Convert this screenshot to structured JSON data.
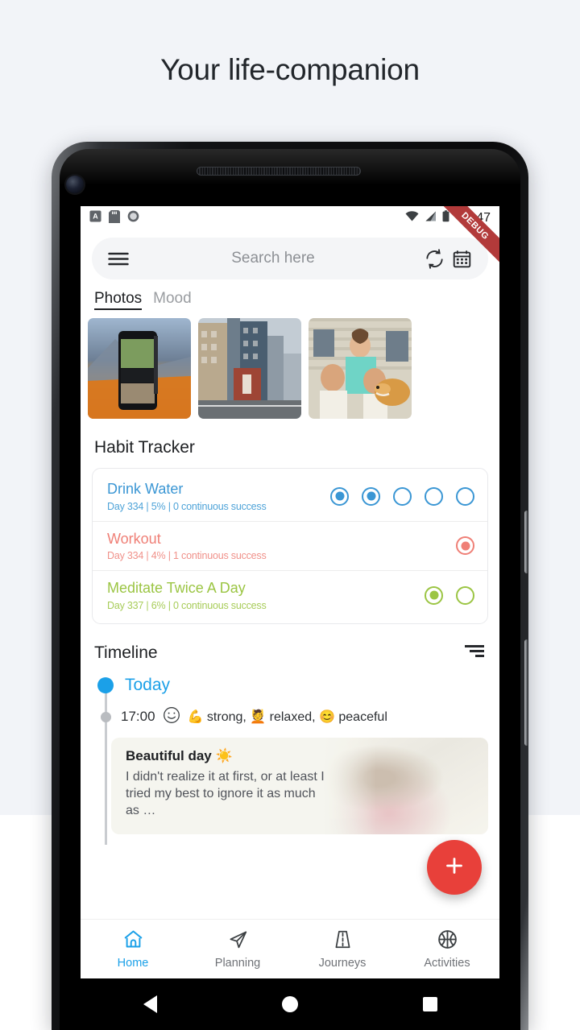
{
  "page": {
    "headline": "Your life-companion",
    "background_top": "#f2f4f8",
    "background_bottom": "#ffffff"
  },
  "statusbar": {
    "time": "10:47",
    "icons": [
      "keyboard-indicator-icon",
      "sd-card-icon",
      "circle-icon",
      "wifi-icon",
      "signal-icon",
      "battery-icon"
    ]
  },
  "debug_ribbon": {
    "label": "DEBUG",
    "color": "#b23a3a"
  },
  "search": {
    "placeholder": "Search here",
    "menu_icon": "hamburger-menu-icon",
    "sync_icon": "sync-icon",
    "calendar_icon": "calendar-icon"
  },
  "tabs": [
    {
      "label": "Photos",
      "active": true
    },
    {
      "label": "Mood",
      "active": false
    }
  ],
  "photos": [
    {
      "alt": "phone on mountain lake landscape"
    },
    {
      "alt": "city high-rise buildings street"
    },
    {
      "alt": "children petting golden retriever dog"
    }
  ],
  "habit_tracker": {
    "title": "Habit Tracker",
    "habits": [
      {
        "name": "Drink Water",
        "meta": "Day 334 | 5% | 0 continuous success",
        "color": "#3a96d4",
        "dots": [
          true,
          true,
          false,
          false,
          false
        ]
      },
      {
        "name": "Workout",
        "meta": "Day 334 | 4% | 1 continuous success",
        "color": "#ef7f76",
        "dots": [
          true
        ]
      },
      {
        "name": "Meditate Twice A Day",
        "meta": "Day 337 | 6% | 0 continuous success",
        "color": "#9bc543",
        "dots": [
          true,
          false
        ]
      }
    ]
  },
  "timeline": {
    "title": "Timeline",
    "sort_icon": "sort-icon",
    "today_label": "Today",
    "today_color": "#1ba0e8",
    "entry": {
      "time": "17:00",
      "mood_face_icon": "smiley-outline-icon",
      "moods": "💪 strong, 💆 relaxed, 😊 peaceful"
    },
    "journal": {
      "title": "Beautiful day ☀️",
      "excerpt": "I didn't realize it at first, or at least I tried my best to ignore it as much as …"
    }
  },
  "fab": {
    "icon": "plus-icon",
    "color": "#e8403a"
  },
  "bottom_nav": [
    {
      "label": "Home",
      "icon": "home-icon",
      "active": true
    },
    {
      "label": "Planning",
      "icon": "paper-plane-icon",
      "active": false
    },
    {
      "label": "Journeys",
      "icon": "road-icon",
      "active": false
    },
    {
      "label": "Activities",
      "icon": "basketball-icon",
      "active": false
    }
  ],
  "android_nav": [
    {
      "label": "back",
      "icon": "triangle-back-icon"
    },
    {
      "label": "home",
      "icon": "circle-home-icon"
    },
    {
      "label": "recents",
      "icon": "square-recents-icon"
    }
  ]
}
